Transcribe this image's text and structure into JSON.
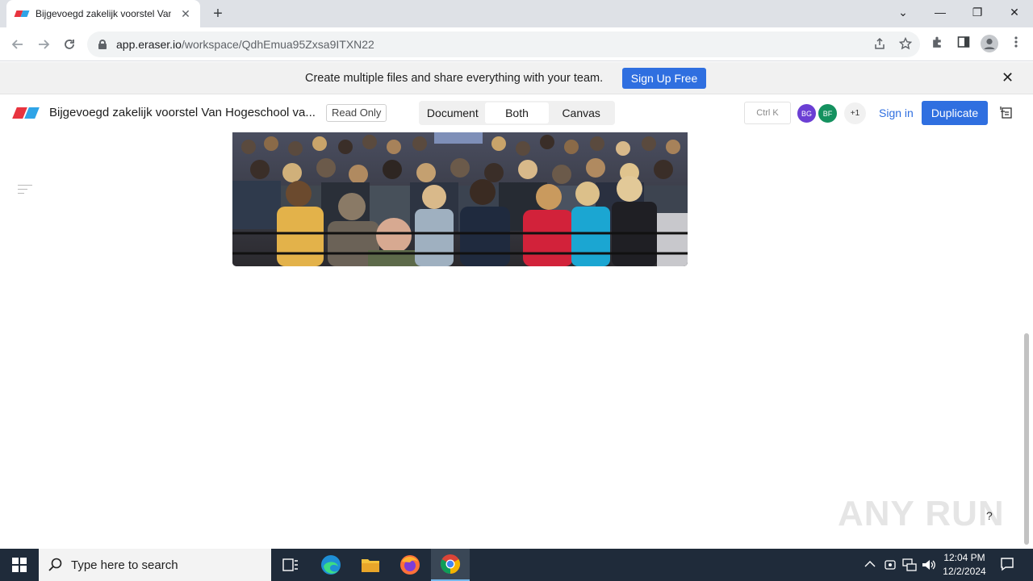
{
  "browser": {
    "tab_title": "Bijgevoegd zakelijk voorstel Van",
    "tab_close": "✕",
    "new_tab": "+",
    "url_host": "app.eraser.io",
    "url_path": "/workspace/QdhEmua95Zxsa9ITXN22",
    "window_controls": {
      "dropdown": "⌄",
      "minimize": "—",
      "restore": "❐",
      "close": "✕"
    },
    "icons": [
      "back-icon",
      "forward-icon",
      "reload-icon",
      "lock-icon",
      "share-icon",
      "star-icon",
      "extensions-icon",
      "sidepanel-icon",
      "profile-icon",
      "menu-icon"
    ]
  },
  "banner": {
    "text": "Create multiple files and share everything with your team.",
    "signup_label": "Sign Up Free",
    "close": "✕"
  },
  "header": {
    "doc_title": "Bijgevoegd zakelijk voorstel Van Hogeschool va...",
    "read_only": "Read Only",
    "views": [
      {
        "label": "Document",
        "active": false
      },
      {
        "label": "Both",
        "active": true
      },
      {
        "label": "Canvas",
        "active": false
      }
    ],
    "shortcut": "Ctrl K",
    "avatars": [
      {
        "initials": "BG",
        "color": "#6b3fd4"
      },
      {
        "initials": "BF",
        "color": "#14915f"
      }
    ],
    "more_users": "+1",
    "sign_in": "Sign in",
    "duplicate": "Duplicate"
  },
  "colors": {
    "accent": "#2f6fe0",
    "logo_red": "#e8343f",
    "logo_blue": "#2fa4e7"
  },
  "overlay": {
    "watermark": "ANY RUN",
    "help": "?"
  },
  "taskbar": {
    "search_placeholder": "Type here to search",
    "apps": [
      "task-view-icon",
      "edge-icon",
      "file-explorer-icon",
      "firefox-icon",
      "chrome-icon"
    ],
    "time": "12:04 PM",
    "date": "12/2/2024"
  }
}
